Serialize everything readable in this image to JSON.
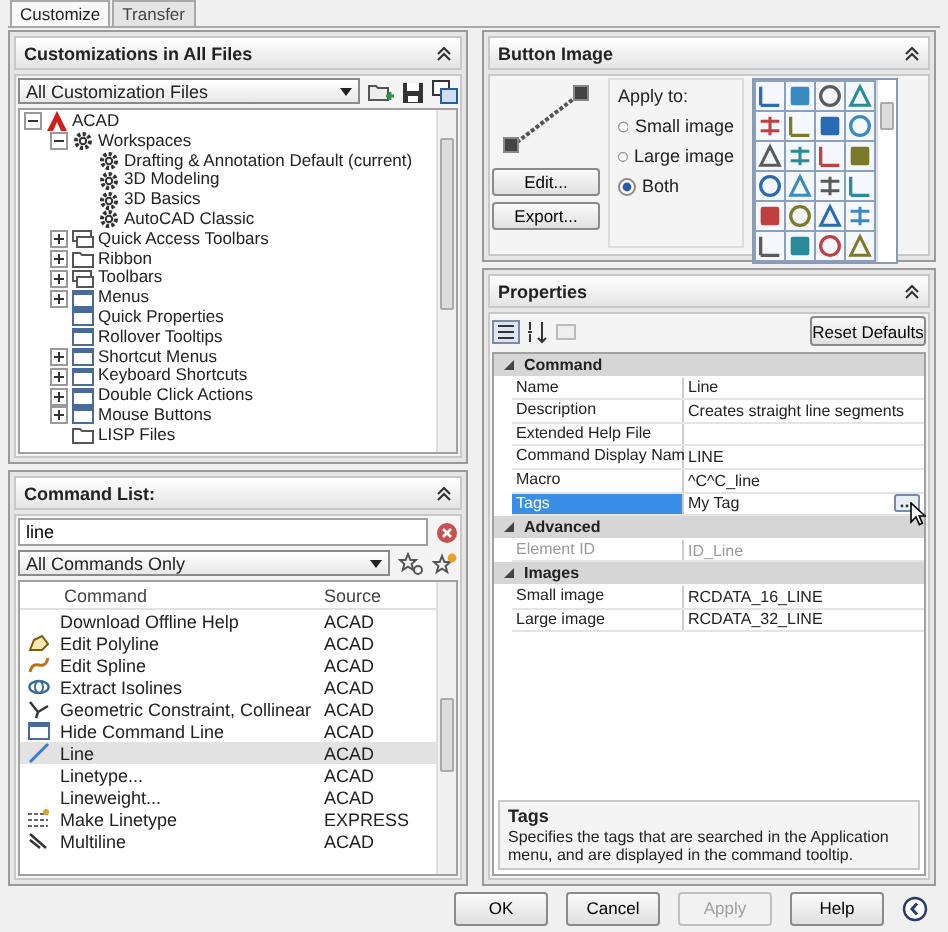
{
  "tabs": [
    {
      "label": "Customize",
      "selected": true
    },
    {
      "label": "Transfer",
      "selected": false
    }
  ],
  "customizations_panel": {
    "title": "Customizations in All Files",
    "filter": "All Customization Files",
    "tree": [
      {
        "label": "ACAD",
        "kind": "acad",
        "expanded": true,
        "children": [
          {
            "label": "Workspaces",
            "kind": "gear",
            "expanded": true,
            "children": [
              {
                "label": "Drafting & Annotation Default (current)",
                "kind": "gear"
              },
              {
                "label": "3D Modeling",
                "kind": "gear"
              },
              {
                "label": "3D Basics",
                "kind": "gear"
              },
              {
                "label": "AutoCAD Classic",
                "kind": "gear"
              }
            ]
          },
          {
            "label": "Quick Access Toolbars",
            "kind": "toolbar",
            "expanded": false
          },
          {
            "label": "Ribbon",
            "kind": "folder",
            "expanded": false
          },
          {
            "label": "Toolbars",
            "kind": "toolbar",
            "expanded": false
          },
          {
            "label": "Menus",
            "kind": "window",
            "expanded": false
          },
          {
            "label": "Quick Properties",
            "kind": "window"
          },
          {
            "label": "Rollover Tooltips",
            "kind": "window"
          },
          {
            "label": "Shortcut Menus",
            "kind": "window",
            "expanded": false
          },
          {
            "label": "Keyboard Shortcuts",
            "kind": "window",
            "expanded": false
          },
          {
            "label": "Double Click Actions",
            "kind": "window",
            "expanded": false
          },
          {
            "label": "Mouse Buttons",
            "kind": "window",
            "expanded": false
          },
          {
            "label": "LISP Files",
            "kind": "folder"
          }
        ]
      }
    ]
  },
  "command_list_panel": {
    "title": "Command List:",
    "search": "line",
    "filter": "All Commands Only",
    "columns": [
      "Command",
      "Source"
    ],
    "rows": [
      {
        "command": "Download Offline Help",
        "source": "ACAD",
        "kind": "none",
        "selected": false
      },
      {
        "command": "Edit Polyline",
        "source": "ACAD",
        "kind": "polyline",
        "selected": false
      },
      {
        "command": "Edit Spline",
        "source": "ACAD",
        "kind": "curve",
        "selected": false
      },
      {
        "command": "Extract Isolines",
        "source": "ACAD",
        "kind": "ellipse",
        "selected": false
      },
      {
        "command": "Geometric Constraint, Collinear",
        "source": "ACAD",
        "kind": "angle",
        "selected": false
      },
      {
        "command": "Hide Command Line",
        "source": "ACAD",
        "kind": "window",
        "selected": false
      },
      {
        "command": "Line",
        "source": "ACAD",
        "kind": "line",
        "selected": true
      },
      {
        "command": "Linetype...",
        "source": "ACAD",
        "kind": "none",
        "selected": false
      },
      {
        "command": "Lineweight...",
        "source": "ACAD",
        "kind": "none",
        "selected": false
      },
      {
        "command": "Make Linetype",
        "source": "EXPRESS",
        "kind": "dashes",
        "selected": false
      },
      {
        "command": "Multiline",
        "source": "ACAD",
        "kind": "parallel",
        "selected": false
      }
    ]
  },
  "button_image_panel": {
    "title": "Button Image",
    "apply_to": "Apply to:",
    "options": [
      {
        "label": "Small image",
        "selected": false
      },
      {
        "label": "Large image",
        "selected": false
      },
      {
        "label": "Both",
        "selected": true
      }
    ],
    "buttons": [
      "Edit...",
      "Export..."
    ]
  },
  "properties_panel": {
    "title": "Properties",
    "reset_button": "Reset Defaults",
    "categories": [
      {
        "name": "Command",
        "expanded": true,
        "rows": [
          {
            "name": "Name",
            "value": "Line",
            "selected": false,
            "disabled": false
          },
          {
            "name": "Description",
            "value": "Creates straight line segments",
            "selected": false,
            "disabled": false
          },
          {
            "name": "Extended Help File",
            "value": "",
            "selected": false,
            "disabled": false
          },
          {
            "name": "Command Display Nam",
            "value": "LINE",
            "selected": false,
            "disabled": false
          },
          {
            "name": "Macro",
            "value": "^C^C_line",
            "selected": false,
            "disabled": false
          },
          {
            "name": "Tags",
            "value": "My Tag",
            "selected": true,
            "disabled": false
          }
        ]
      },
      {
        "name": "Advanced",
        "expanded": true,
        "rows": [
          {
            "name": "Element ID",
            "value": "ID_Line",
            "selected": false,
            "disabled": true
          }
        ]
      },
      {
        "name": "Images",
        "expanded": true,
        "rows": [
          {
            "name": "Small image",
            "value": "RCDATA_16_LINE",
            "selected": false,
            "disabled": false
          },
          {
            "name": "Large image",
            "value": "RCDATA_32_LINE",
            "selected": false,
            "disabled": false
          }
        ]
      }
    ],
    "description": {
      "title": "Tags",
      "text": "Specifies the tags that are searched in the Application menu, and are displayed in the command tooltip."
    }
  },
  "footer_buttons": [
    {
      "label": "OK",
      "disabled": false
    },
    {
      "label": "Cancel",
      "disabled": false
    },
    {
      "label": "Apply",
      "disabled": true
    },
    {
      "label": "Help",
      "disabled": false
    }
  ]
}
